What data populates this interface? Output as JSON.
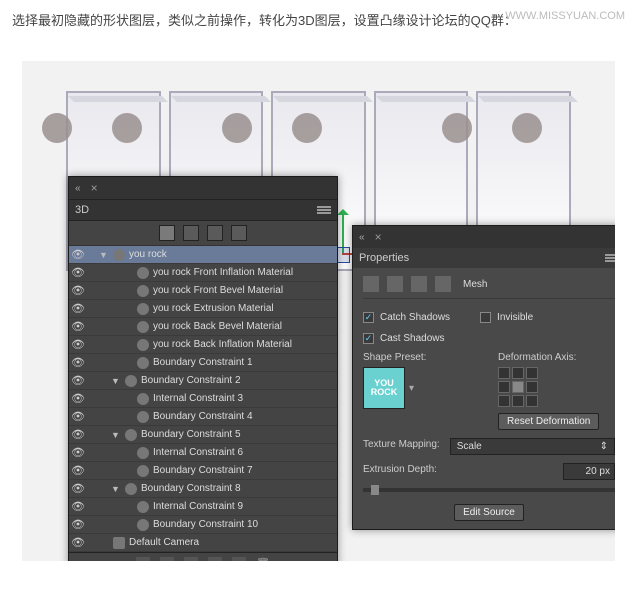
{
  "top_text": "选择最初隐藏的形状图层，类似之前操作，转化为3D图层，设置凸缘设计论坛的QQ群：",
  "watermark": "WWW.MISSYUAN.COM",
  "panel3d": {
    "title": "3D",
    "nodes": [
      {
        "label": "you rock",
        "indent": 1,
        "vis": true,
        "arrow": "▼",
        "selected": true
      },
      {
        "label": "you rock Front Inflation Material",
        "indent": 3,
        "vis": true,
        "arrow": ""
      },
      {
        "label": "you rock Front Bevel Material",
        "indent": 3,
        "vis": true,
        "arrow": ""
      },
      {
        "label": "you rock Extrusion Material",
        "indent": 3,
        "vis": true,
        "arrow": ""
      },
      {
        "label": "you rock Back Bevel Material",
        "indent": 3,
        "vis": true,
        "arrow": ""
      },
      {
        "label": "you rock Back Inflation Material",
        "indent": 3,
        "vis": true,
        "arrow": ""
      },
      {
        "label": "Boundary Constraint 1",
        "indent": 3,
        "vis": true,
        "arrow": ""
      },
      {
        "label": "Boundary Constraint 2",
        "indent": 2,
        "vis": true,
        "arrow": "▼"
      },
      {
        "label": "Internal Constraint 3",
        "indent": 3,
        "vis": true,
        "arrow": ""
      },
      {
        "label": "Boundary Constraint 4",
        "indent": 3,
        "vis": true,
        "arrow": ""
      },
      {
        "label": "Boundary Constraint 5",
        "indent": 2,
        "vis": true,
        "arrow": "▼"
      },
      {
        "label": "Internal Constraint 6",
        "indent": 3,
        "vis": true,
        "arrow": ""
      },
      {
        "label": "Boundary Constraint 7",
        "indent": 3,
        "vis": true,
        "arrow": ""
      },
      {
        "label": "Boundary Constraint 8",
        "indent": 2,
        "vis": true,
        "arrow": "▼"
      },
      {
        "label": "Internal Constraint 9",
        "indent": 3,
        "vis": true,
        "arrow": ""
      },
      {
        "label": "Boundary Constraint 10",
        "indent": 3,
        "vis": true,
        "arrow": ""
      },
      {
        "label": "Default Camera",
        "indent": 1,
        "vis": true,
        "arrow": "",
        "icon": "cam"
      }
    ]
  },
  "props": {
    "title": "Properties",
    "mesh_label": "Mesh",
    "catch_shadows": "Catch Shadows",
    "cast_shadows": "Cast Shadows",
    "invisible": "Invisible",
    "shape_preset": "Shape Preset:",
    "preset_text": "YOU ROCK",
    "deformation_axis": "Deformation Axis:",
    "reset_deformation": "Reset Deformation",
    "texture_mapping": "Texture Mapping:",
    "texture_value": "Scale",
    "extrusion_depth": "Extrusion Depth:",
    "extrusion_value": "20 px",
    "edit_source": "Edit Source"
  }
}
